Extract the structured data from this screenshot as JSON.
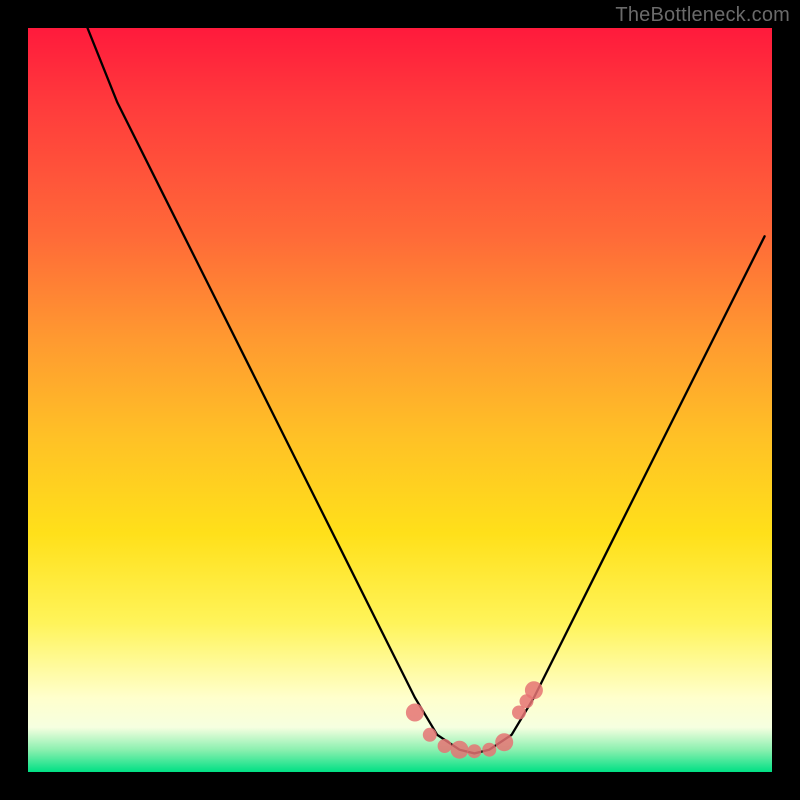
{
  "attribution": "TheBottleneck.com",
  "chart_data": {
    "type": "line",
    "title": "",
    "xlabel": "",
    "ylabel": "",
    "xlim": [
      0,
      100
    ],
    "ylim": [
      0,
      100
    ],
    "series": [
      {
        "name": "curve",
        "x": [
          8,
          12,
          18,
          24,
          30,
          36,
          42,
          48,
          52,
          55,
          58,
          60,
          62,
          65,
          68,
          72,
          78,
          85,
          92,
          99
        ],
        "y": [
          100,
          90,
          78,
          66,
          54,
          42,
          30,
          18,
          10,
          5,
          3,
          2.5,
          3,
          5,
          10,
          18,
          30,
          44,
          58,
          72
        ]
      }
    ],
    "markers": {
      "name": "red-dots",
      "x": [
        52,
        54,
        56,
        58,
        60,
        62,
        64,
        66,
        67,
        68
      ],
      "y": [
        8,
        5,
        3.5,
        3,
        2.8,
        3,
        4,
        8,
        9.5,
        11
      ]
    },
    "background_gradient_description": "vertical red-to-green heatmap"
  }
}
